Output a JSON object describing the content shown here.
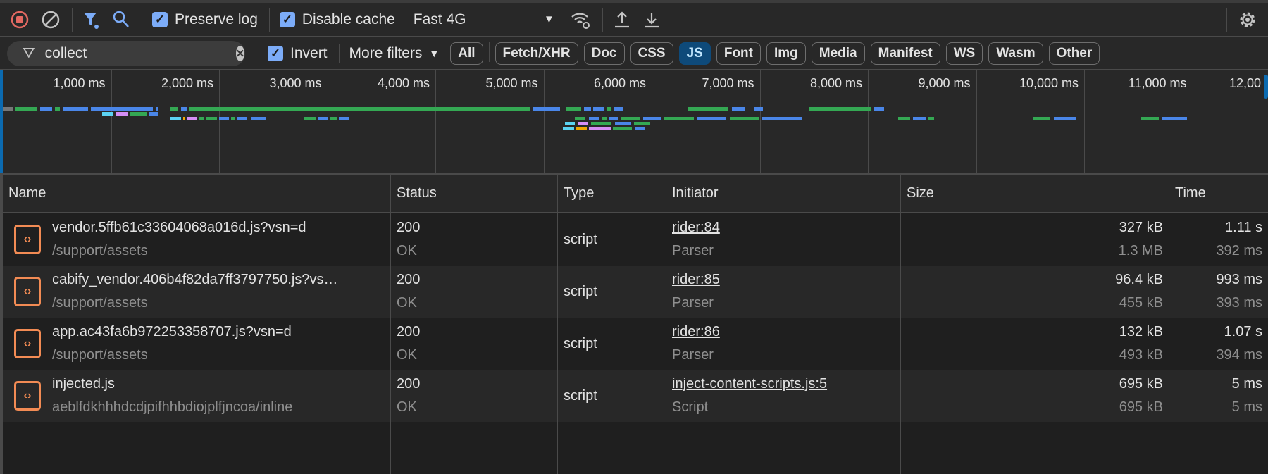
{
  "toolbar": {
    "preserve_log": "Preserve log",
    "disable_cache": "Disable cache",
    "throttling": "Fast 4G",
    "preserve_checked": true,
    "disable_checked": true
  },
  "filter": {
    "value": "collect",
    "invert_label": "Invert",
    "more_filters": "More filters",
    "chips": [
      "All",
      "Fetch/XHR",
      "Doc",
      "CSS",
      "JS",
      "Font",
      "Img",
      "Media",
      "Manifest",
      "WS",
      "Wasm",
      "Other"
    ],
    "active_chip": "JS"
  },
  "overview": {
    "ticks": [
      "1,000 ms",
      "2,000 ms",
      "3,000 ms",
      "4,000 ms",
      "5,000 ms",
      "6,000 ms",
      "7,000 ms",
      "8,000 ms",
      "9,000 ms",
      "10,000 ms",
      "11,000 ms",
      "12,00"
    ],
    "colors": {
      "g": "#34a853",
      "b": "#4a86e8",
      "c": "#5bd3f3",
      "p": "#d58ef5",
      "o": "#f2a600",
      "k": "#777777"
    },
    "bars": [
      [
        0,
        100,
        0,
        "k"
      ],
      [
        120,
        330,
        0,
        "g"
      ],
      [
        345,
        465,
        0,
        "b"
      ],
      [
        480,
        540,
        0,
        "g"
      ],
      [
        560,
        800,
        0,
        "b"
      ],
      [
        815,
        1400,
        0,
        "b"
      ],
      [
        1415,
        1440,
        0,
        "b"
      ],
      [
        1545,
        1630,
        0,
        "g"
      ],
      [
        1645,
        1710,
        0,
        "b"
      ],
      [
        1720,
        4890,
        0,
        "g"
      ],
      [
        4905,
        5160,
        0,
        "b"
      ],
      [
        5210,
        5360,
        0,
        "g"
      ],
      [
        5375,
        5450,
        0,
        "b"
      ],
      [
        5460,
        5570,
        0,
        "b"
      ],
      [
        5580,
        5640,
        0,
        "g"
      ],
      [
        5650,
        5750,
        0,
        "b"
      ],
      [
        6340,
        6720,
        0,
        "g"
      ],
      [
        6740,
        6870,
        0,
        "b"
      ],
      [
        6950,
        7040,
        0,
        "b"
      ],
      [
        7460,
        8040,
        0,
        "g"
      ],
      [
        8060,
        8160,
        0,
        "b"
      ],
      [
        920,
        1030,
        1,
        "c"
      ],
      [
        1050,
        1170,
        1,
        "p"
      ],
      [
        1180,
        1340,
        1,
        "g"
      ],
      [
        1350,
        1440,
        1,
        "b"
      ],
      [
        1545,
        1660,
        2,
        "c"
      ],
      [
        1670,
        1690,
        2,
        "o"
      ],
      [
        1700,
        1800,
        2,
        "p"
      ],
      [
        1810,
        1870,
        2,
        "g"
      ],
      [
        1880,
        1990,
        2,
        "g"
      ],
      [
        2000,
        2100,
        2,
        "b"
      ],
      [
        2110,
        2150,
        2,
        "g"
      ],
      [
        2160,
        2270,
        2,
        "b"
      ],
      [
        2300,
        2440,
        2,
        "b"
      ],
      [
        2790,
        2910,
        2,
        "g"
      ],
      [
        2920,
        3020,
        2,
        "b"
      ],
      [
        3030,
        3100,
        2,
        "g"
      ],
      [
        3110,
        3210,
        2,
        "b"
      ],
      [
        5290,
        5400,
        2,
        "g"
      ],
      [
        5420,
        5520,
        2,
        "b"
      ],
      [
        5540,
        5590,
        2,
        "g"
      ],
      [
        5600,
        5700,
        2,
        "b"
      ],
      [
        5720,
        5900,
        2,
        "g"
      ],
      [
        5920,
        6100,
        2,
        "b"
      ],
      [
        6120,
        6400,
        2,
        "g"
      ],
      [
        6420,
        6700,
        2,
        "b"
      ],
      [
        6720,
        7000,
        2,
        "g"
      ],
      [
        7020,
        7400,
        2,
        "b"
      ],
      [
        5200,
        5300,
        3,
        "c"
      ],
      [
        5320,
        5420,
        3,
        "p"
      ],
      [
        5440,
        5640,
        3,
        "g"
      ],
      [
        5660,
        5820,
        3,
        "b"
      ],
      [
        5840,
        6000,
        3,
        "g"
      ],
      [
        5180,
        5290,
        4,
        "c"
      ],
      [
        5300,
        5410,
        4,
        "o"
      ],
      [
        5420,
        5630,
        4,
        "p"
      ],
      [
        5640,
        5830,
        4,
        "g"
      ],
      [
        5850,
        5950,
        4,
        "b"
      ],
      [
        8280,
        8400,
        2,
        "g"
      ],
      [
        8420,
        8550,
        2,
        "b"
      ],
      [
        8560,
        8620,
        2,
        "g"
      ],
      [
        9530,
        9700,
        2,
        "g"
      ],
      [
        9720,
        9930,
        2,
        "b"
      ],
      [
        10530,
        10700,
        2,
        "g"
      ],
      [
        10720,
        10960,
        2,
        "b"
      ]
    ],
    "marker_ms": 1545
  },
  "table": {
    "headers": [
      "Name",
      "Status",
      "Type",
      "Initiator",
      "Size",
      "Time"
    ],
    "rows": [
      {
        "name": "vendor.5ffb61c33604068a016d.js?vsn=d",
        "path": "/support/assets",
        "status": "200",
        "status_text": "OK",
        "type": "script",
        "initiator": "rider:84",
        "initiator_type": "Parser",
        "size": "327 kB",
        "resource_size": "1.3 MB",
        "time": "1.11 s",
        "latency": "392 ms"
      },
      {
        "name": "cabify_vendor.406b4f82da7ff3797750.js?vs…",
        "path": "/support/assets",
        "status": "200",
        "status_text": "OK",
        "type": "script",
        "initiator": "rider:85",
        "initiator_type": "Parser",
        "size": "96.4 kB",
        "resource_size": "455 kB",
        "time": "993 ms",
        "latency": "393 ms"
      },
      {
        "name": "app.ac43fa6b972253358707.js?vsn=d",
        "path": "/support/assets",
        "status": "200",
        "status_text": "OK",
        "type": "script",
        "initiator": "rider:86",
        "initiator_type": "Parser",
        "size": "132 kB",
        "resource_size": "493 kB",
        "time": "1.07 s",
        "latency": "394 ms"
      },
      {
        "name": "injected.js",
        "path": "aeblfdkhhhdcdjpifhhbdiojplfjncoa/inline",
        "status": "200",
        "status_text": "OK",
        "type": "script",
        "initiator": "inject-content-scripts.js:5",
        "initiator_type": "Script",
        "size": "695 kB",
        "resource_size": "695 kB",
        "time": "5 ms",
        "latency": "5 ms"
      }
    ]
  }
}
